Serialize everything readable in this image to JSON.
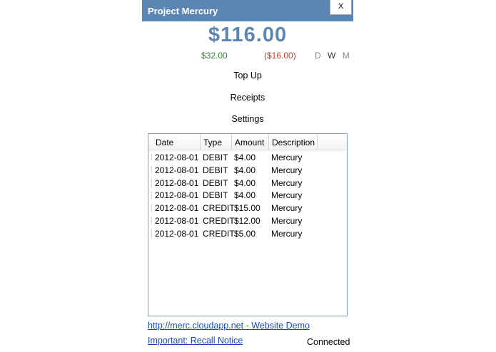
{
  "window": {
    "title": "Project Mercury",
    "close_label": "X"
  },
  "summary": {
    "balance": "$116.00",
    "credit": "$32.00",
    "debit": "($16.00)",
    "periods": [
      "D",
      "W",
      "M"
    ]
  },
  "menu": {
    "top_up": "Top Up",
    "receipts": "Receipts",
    "settings": "Settings"
  },
  "table": {
    "columns": [
      "Date",
      "Type",
      "Amount",
      "Description"
    ],
    "rows": [
      [
        "2012-08-01",
        "DEBIT",
        "$4.00",
        "Mercury"
      ],
      [
        "2012-08-01",
        "DEBIT",
        "$4.00",
        "Mercury"
      ],
      [
        "2012-08-01",
        "DEBIT",
        "$4.00",
        "Mercury"
      ],
      [
        "2012-08-01",
        "DEBIT",
        "$4.00",
        "Mercury"
      ],
      [
        "2012-08-01",
        "CREDIT",
        "$15.00",
        "Mercury"
      ],
      [
        "2012-08-01",
        "CREDIT",
        "$12.00",
        "Mercury"
      ],
      [
        "2012-08-01",
        "CREDIT",
        "$5.00",
        "Mercury"
      ]
    ]
  },
  "footer": {
    "demo_link": "http://merc.cloudapp.net - Website Demo",
    "recall_link": "Important: Recall Notice",
    "status": "Connected"
  },
  "colors": {
    "titlebar": "#5b86b3",
    "balance": "#5b86b3",
    "credit": "#2e8b2e",
    "debit": "#c0392b",
    "link": "#1a47b8"
  }
}
